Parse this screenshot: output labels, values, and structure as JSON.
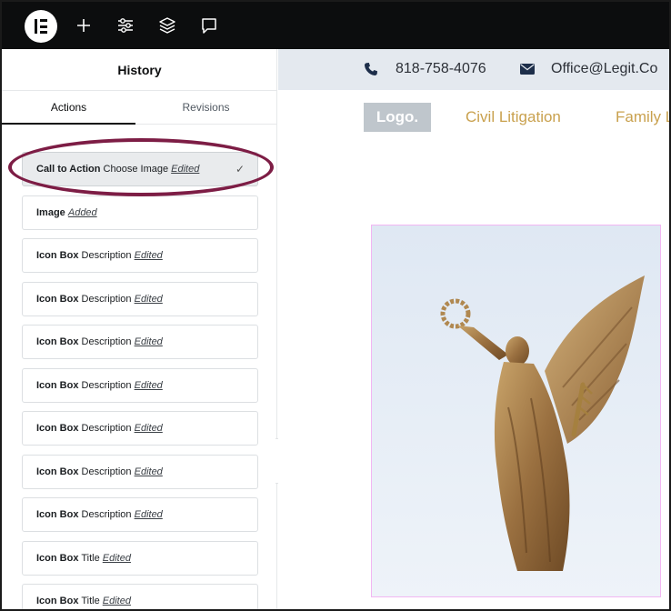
{
  "toolbar": {
    "icons": [
      "elementor-logo-icon",
      "plus-icon",
      "sliders-icon",
      "layers-icon",
      "comment-icon"
    ]
  },
  "panel": {
    "title": "History",
    "tabs": [
      {
        "label": "Actions",
        "active": true
      },
      {
        "label": "Revisions",
        "active": false
      }
    ],
    "items": [
      {
        "element": "Call to Action",
        "detail": "Choose Image",
        "action": "Edited",
        "active": true
      },
      {
        "element": "Image",
        "detail": "",
        "action": "Added",
        "active": false
      },
      {
        "element": "Icon Box",
        "detail": "Description",
        "action": "Edited",
        "active": false
      },
      {
        "element": "Icon Box",
        "detail": "Description",
        "action": "Edited",
        "active": false
      },
      {
        "element": "Icon Box",
        "detail": "Description",
        "action": "Edited",
        "active": false
      },
      {
        "element": "Icon Box",
        "detail": "Description",
        "action": "Edited",
        "active": false
      },
      {
        "element": "Icon Box",
        "detail": "Description",
        "action": "Edited",
        "active": false
      },
      {
        "element": "Icon Box",
        "detail": "Description",
        "action": "Edited",
        "active": false
      },
      {
        "element": "Icon Box",
        "detail": "Description",
        "action": "Edited",
        "active": false
      },
      {
        "element": "Icon Box",
        "detail": "Title",
        "action": "Edited",
        "active": false
      },
      {
        "element": "Icon Box",
        "detail": "Title",
        "action": "Edited",
        "active": false
      }
    ],
    "collapse_glyph": "‹",
    "check_glyph": "✓"
  },
  "preview": {
    "phone": "818-758-4076",
    "email": "Office@Legit.Co",
    "logo": "Logo.",
    "nav": [
      "Civil Litigation",
      "Family L"
    ]
  },
  "colors": {
    "topbar": "#0c0d0e",
    "highlight_ellipse": "#7d1d45",
    "nav_gold": "#c9a14e",
    "info_bar": "#e4e9ef",
    "icon_navy": "#1d2e4a"
  }
}
